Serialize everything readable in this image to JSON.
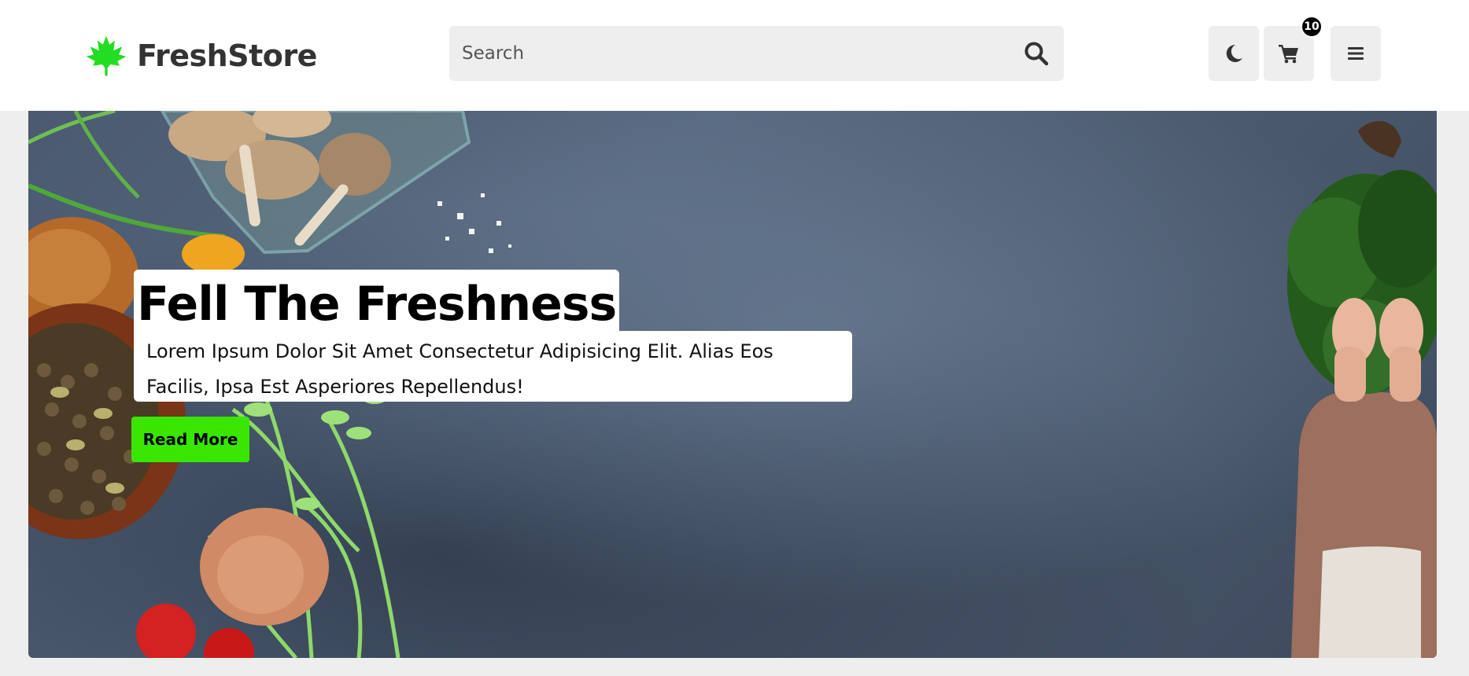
{
  "header": {
    "brand_name": "FreshStore",
    "logo_icon": "maple-leaf-icon",
    "search": {
      "placeholder": "Search",
      "value": "",
      "icon": "search-icon"
    },
    "actions": [
      {
        "name": "theme-toggle",
        "icon": "moon-icon"
      },
      {
        "name": "cart",
        "icon": "cart-icon",
        "badge": "10"
      },
      {
        "name": "menu",
        "icon": "hamburger-icon"
      }
    ]
  },
  "hero": {
    "title": "Fell The Freshness",
    "text": "Lorem Ipsum Dolor Sit Amet Consectetur Adipisicing Elit. Alias Eos Facilis, Ipsa Est Asperiores Repellendus!",
    "button_label": "Read More"
  },
  "colors": {
    "accent": "#39e600",
    "page_bg": "#eeeeee",
    "header_bg": "#ffffff",
    "text_dark": "#333333",
    "hero_bg": "#4b5a70"
  }
}
